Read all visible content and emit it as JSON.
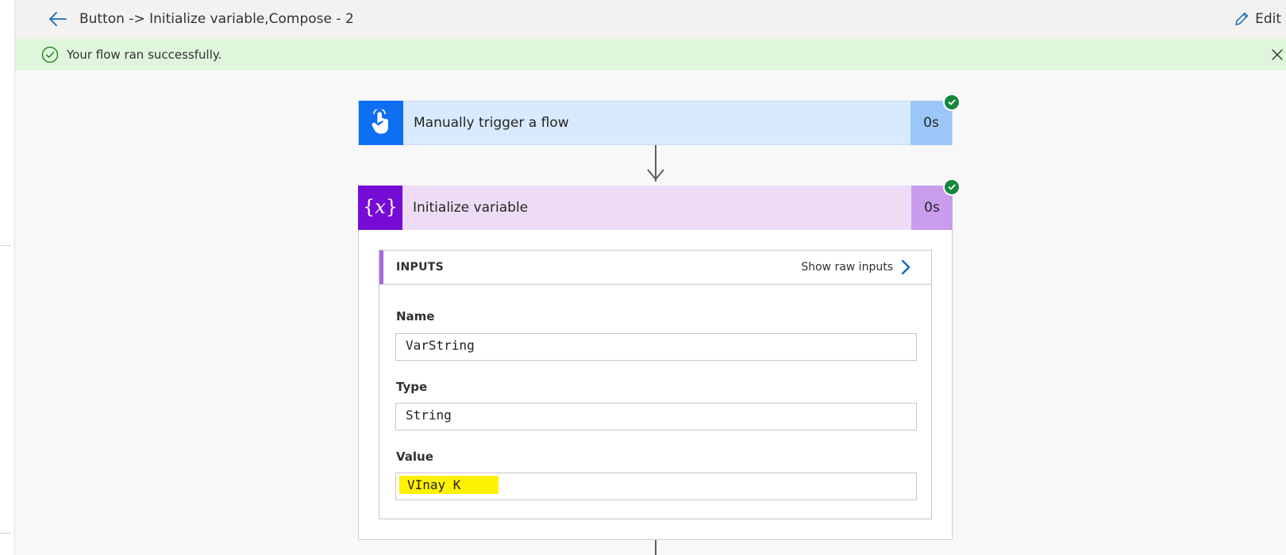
{
  "header": {
    "title": "Button -> Initialize variable,Compose - 2",
    "edit_label": "Edit"
  },
  "banner": {
    "message": "Your flow ran successfully."
  },
  "flow": {
    "steps": [
      {
        "title": "Manually trigger a flow",
        "duration": "0s",
        "status": "succeeded",
        "icon": "touch-hand-icon"
      },
      {
        "title": "Initialize variable",
        "duration": "0s",
        "status": "succeeded",
        "icon": "variable-icon"
      }
    ]
  },
  "inputs": {
    "heading": "INPUTS",
    "raw_link": "Show raw inputs",
    "fields": [
      {
        "label": "Name",
        "value": "VarString"
      },
      {
        "label": "Type",
        "value": "String"
      },
      {
        "label": "Value",
        "value": "VInay K"
      }
    ]
  },
  "colors": {
    "success": "#14873e",
    "banner_bg": "#dff6dd",
    "trigger_accent": "#0e6ff3",
    "variable_accent": "#770bd6",
    "link_blue": "#0f6cbd",
    "highlight": "#fff200"
  }
}
